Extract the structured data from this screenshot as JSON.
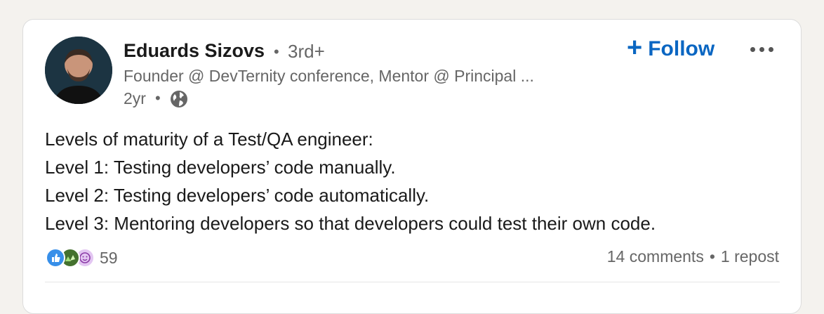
{
  "post": {
    "author": {
      "name": "Eduards Sizovs",
      "degree": "3rd+",
      "headline": "Founder @ DevTernity conference, Mentor @ Principal ...",
      "time": "2yr"
    },
    "follow_label": "Follow",
    "lines": [
      "Levels of maturity of a Test/QA engineer:",
      "Level 1: Testing developers’ code manually.",
      "Level 2: Testing developers’ code automatically.",
      "Level 3: Mentoring developers so that developers could test their own code."
    ],
    "reaction_count": "59",
    "comments": "14 comments",
    "reposts": "1 repost",
    "icons": {
      "globe": "globe-icon",
      "more": "more-options-icon",
      "reactions": [
        "like-reaction-icon",
        "celebrate-reaction-icon",
        "funny-reaction-icon"
      ]
    },
    "colors": {
      "accent": "#0a66c2",
      "background": "#f4f2ee",
      "card": "#ffffff"
    }
  }
}
